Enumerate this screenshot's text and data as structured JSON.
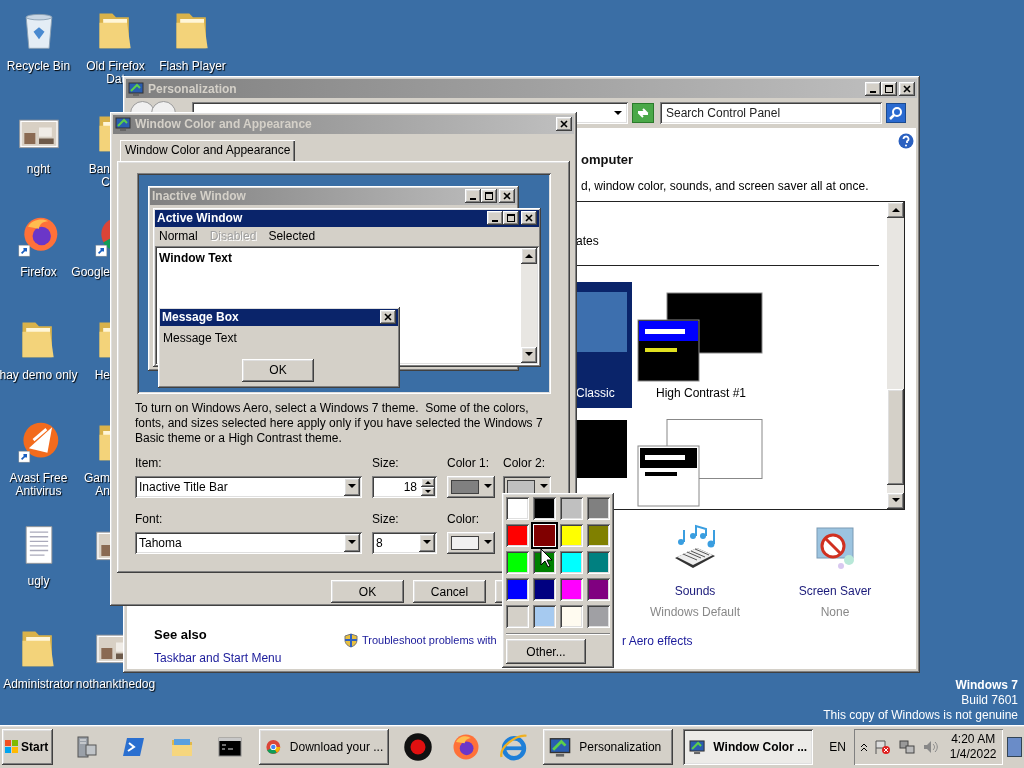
{
  "desktop": {
    "columns": [
      [
        {
          "kind": "bin",
          "lines": [
            "Recycle Bin"
          ]
        },
        {
          "kind": "photo",
          "lines": [
            "nght"
          ]
        },
        {
          "kind": "firefox",
          "lines": [
            "Firefox"
          ]
        },
        {
          "kind": "folder",
          "lines": [
            "hay demo only"
          ]
        },
        {
          "kind": "avast",
          "lines": [
            "Avast Free",
            "Antivirus"
          ]
        },
        {
          "kind": "doc",
          "lines": [
            "ugly"
          ]
        },
        {
          "kind": "folder",
          "lines": [
            "Administrator"
          ]
        }
      ],
      [
        {
          "kind": "folder",
          "lines": [
            "Old Firefox",
            "Dat"
          ],
          "truncated": false
        },
        {
          "kind": "folder",
          "lines": [
            "Ban",
            "C"
          ],
          "truncated": true
        },
        {
          "kind": "chrome",
          "lines": [
            "Google"
          ],
          "truncated": true
        },
        {
          "kind": "folder",
          "lines": [
            "He"
          ],
          "truncated": true
        },
        {
          "kind": "folder",
          "lines": [
            "Gam",
            "An"
          ],
          "truncated": true
        },
        {
          "kind": "photo"
        },
        {
          "kind": "photo",
          "lines": [
            "nothankthedog"
          ],
          "truncated": false
        }
      ],
      [
        {
          "kind": "folder",
          "lines": [
            "Flash Player"
          ],
          "truncated": false
        }
      ]
    ],
    "watermark": {
      "edition": "Windows 7",
      "build": "Build 7601",
      "notice": "This copy of Windows is not genuine"
    }
  },
  "personalization": {
    "title": "Personalization",
    "search": {
      "placeholder": "Search Control Panel"
    },
    "heading": "omputer",
    "description": "d, window color, sounds, and screen saver all at once.",
    "list_fragment": "ates",
    "themes": [
      {
        "label": "Classic",
        "selected": true
      },
      {
        "label": "High Contrast #1",
        "selected": false
      },
      {
        "selected": false
      },
      {
        "selected": false
      }
    ],
    "items": [
      {
        "kind": "sounds",
        "title": "Sounds",
        "value": "Windows Default"
      },
      {
        "kind": "screensaver",
        "title": "Screen Saver",
        "value": "None"
      }
    ],
    "see_also": {
      "title": "See also",
      "links": [
        "Taskbar and Start Menu"
      ]
    },
    "troubleshoot": [
      "Troubleshoot problems with",
      "r Aero effects"
    ]
  },
  "dialog": {
    "title": "Window Color and Appearance",
    "tabs": [
      {
        "label": "Window Color and Appearance",
        "selected": true
      }
    ],
    "preview": {
      "inactive_title": "Inactive Window",
      "active_title": "Active Window",
      "menu": [
        {
          "label": "Normal",
          "disabled": false
        },
        {
          "label": "Disabled",
          "disabled": true
        },
        {
          "label": "Selected",
          "disabled": false
        }
      ],
      "window_text": "Window Text",
      "message_box": {
        "title": "Message Box",
        "text": "Message Text",
        "button": "OK"
      }
    },
    "note": "To turn on Windows Aero, select a Windows 7 theme.  Some of the colors, fonts, and sizes selected here apply only if you have selected the Windows 7 Basic theme or a High Contrast theme.",
    "item": {
      "label": "Item:",
      "value": "Inactive Title Bar"
    },
    "item_size": {
      "label": "Size:",
      "value": "18"
    },
    "color1": {
      "label": "Color 1:",
      "color": "#808080",
      "open": false
    },
    "color2": {
      "label": "Color 2:",
      "color": "#c0c0c0",
      "open": true
    },
    "font": {
      "label": "Font:",
      "value": "Tahoma"
    },
    "font_size": {
      "label": "Size:",
      "value": "8"
    },
    "font_color": {
      "label": "Color:",
      "color": "#f0f0f0",
      "open": false
    },
    "buttons": [
      "OK",
      "Cancel"
    ]
  },
  "color_picker": {
    "swatches": [
      {
        "color": "#ffffff",
        "selected": false
      },
      {
        "color": "#000000",
        "selected": false
      },
      {
        "color": "#c0c0c0",
        "selected": false
      },
      {
        "color": "#808080",
        "selected": false
      },
      {
        "color": "#ff0000",
        "selected": false
      },
      {
        "color": "#800000",
        "selected": true
      },
      {
        "color": "#ffff00",
        "selected": false
      },
      {
        "color": "#808000",
        "selected": false
      },
      {
        "color": "#00ff00",
        "selected": false
      },
      {
        "color": "#008000",
        "selected": false
      },
      {
        "color": "#00ffff",
        "selected": false
      },
      {
        "color": "#008080",
        "selected": false
      },
      {
        "color": "#0000ff",
        "selected": false
      },
      {
        "color": "#000080",
        "selected": false
      },
      {
        "color": "#ff00ff",
        "selected": false
      },
      {
        "color": "#800080",
        "selected": false
      },
      {
        "color": "#d4d0c8",
        "selected": false
      },
      {
        "color": "#a6caf0",
        "selected": false
      },
      {
        "color": "#fffbf0",
        "selected": false
      },
      {
        "color": "#a0a0a4",
        "selected": false
      }
    ],
    "other": "Other..."
  },
  "taskbar": {
    "start": "Start",
    "items": [
      {
        "kind": "launcher"
      },
      {
        "kind": "launcher"
      },
      {
        "kind": "launcher"
      },
      {
        "kind": "launcher"
      },
      {
        "kind": "task",
        "label": "Download your ...",
        "selected": false
      },
      {
        "kind": "launcher"
      },
      {
        "kind": "launcher"
      },
      {
        "kind": "launcher"
      },
      {
        "kind": "task",
        "label": "Personalization",
        "selected": false
      },
      {
        "kind": "task",
        "label": "Window Color ...",
        "selected": true
      }
    ],
    "language": "EN",
    "clock": {
      "time": "4:20 AM",
      "date": "1/4/2022"
    }
  }
}
